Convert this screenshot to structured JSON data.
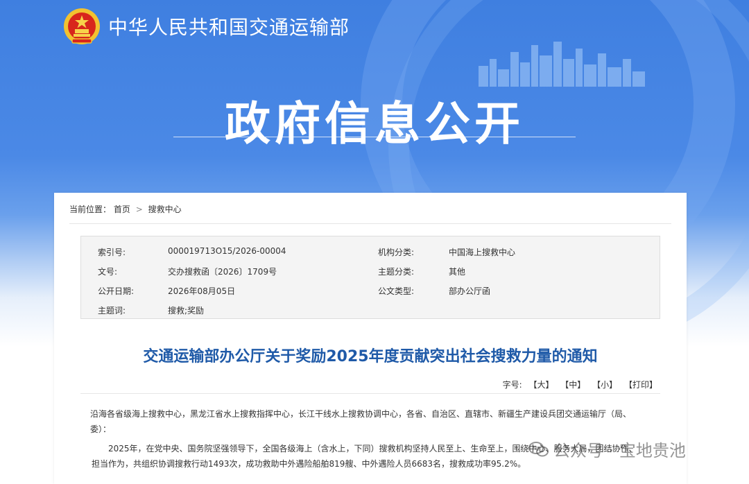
{
  "header": {
    "ministry_name": "中华人民共和国交通运输部",
    "section_title": "政府信息公开"
  },
  "breadcrumb": {
    "prefix": "当前位置：",
    "home": "首页",
    "separator": ">",
    "current": "搜救中心"
  },
  "meta": {
    "index_label": "索引号:",
    "index_value": "000019713O15/2026-00004",
    "org_label": "机构分类:",
    "org_value": "中国海上搜救中心",
    "doc_no_label": "文号:",
    "doc_no_value": "交办搜救函〔2026〕1709号",
    "topic_label": "主题分类:",
    "topic_value": "其他",
    "date_label": "公开日期:",
    "date_value": "2026年08月05日",
    "type_label": "公文类型:",
    "type_value": "部办公厅函",
    "keywords_label": "主题词:",
    "keywords_value": "搜救;奖励"
  },
  "document": {
    "title": "交通运输部办公厅关于奖励2025年度贡献突出社会搜救力量的通知",
    "font_size_label": "字号:",
    "size_large": "【大】",
    "size_medium": "【中】",
    "size_small": "【小】",
    "print": "【打印】",
    "paragraph_1": "沿海各省级海上搜救中心，黑龙江省水上搜救指挥中心，长江干线水上搜救协调中心，各省、自治区、直辖市、新疆生产建设兵团交通运输厅（局、委）：",
    "paragraph_2": "2025年，在党中央、国务院坚强领导下，全国各级海上（含水上，下同）搜救机构坚持人民至上、生命至上，围绕中心、服务大局，团结协作、担当作为，共组织协调搜救行动1493次，成功救助中外遇险船舶819艘、中外遇险人员6683名，搜救成功率95.2%。"
  },
  "watermark": {
    "text": "公众号 · 宝地贵池"
  },
  "colors": {
    "hero_blue": "#4b89e6",
    "title_blue": "#1f5aa8"
  }
}
